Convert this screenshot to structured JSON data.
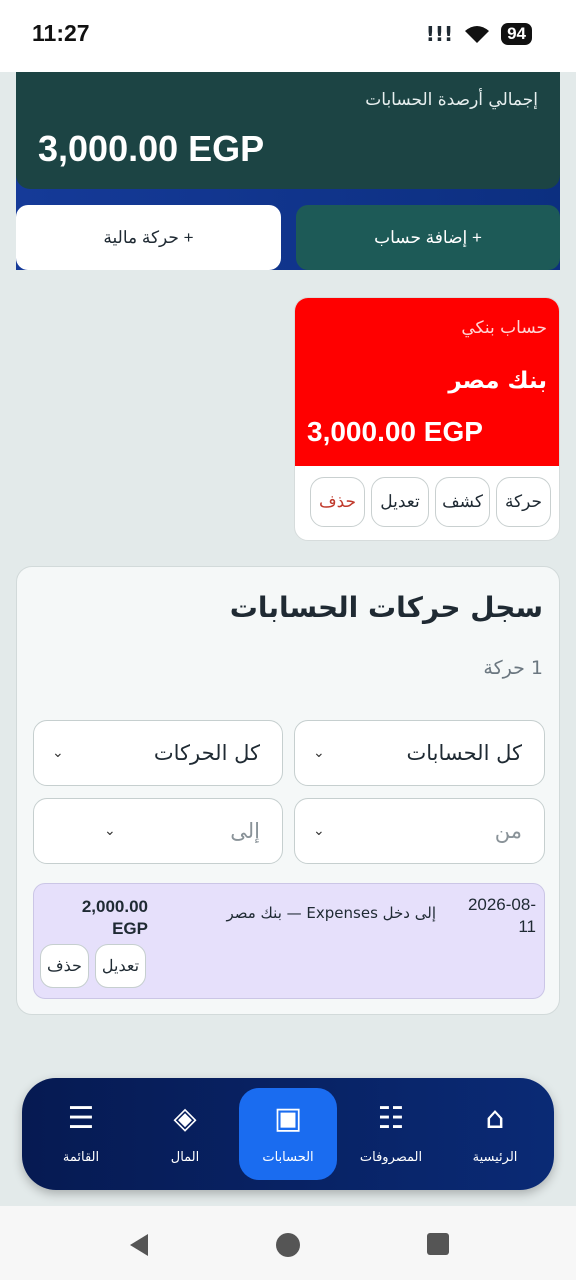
{
  "status_bar": {
    "time": "11:27",
    "battery": "94"
  },
  "summary": {
    "label": "إجمالي أرصدة الحسابات",
    "amount": "3,000.00 EGP"
  },
  "actions": {
    "add_transaction": "+ حركة مالية",
    "add_account": "+ إضافة حساب"
  },
  "account": {
    "type": "حساب بنكي",
    "name": "بنك مصر",
    "balance": "3,000.00 EGP",
    "color": "#ff0000",
    "buttons": [
      "حركة",
      "كشف",
      "تعديل",
      "حذف"
    ]
  },
  "log": {
    "title": "سجل حركات الحسابات",
    "count": "1 حركة",
    "filters": {
      "accounts": "كل الحسابات",
      "movements": "كل الحركات",
      "from": "من",
      "to": "إلى"
    },
    "transactions": [
      {
        "date": "2026-08-11",
        "description": "إلى دخل Expenses — بنك مصر",
        "amount": "2,000.00 EGP",
        "edit": "تعديل",
        "delete": "حذف"
      }
    ]
  },
  "nav": {
    "items": [
      {
        "label": "الرئيسية",
        "icon": "home-icon"
      },
      {
        "label": "المصروفات",
        "icon": "list-icon"
      },
      {
        "label": "الحسابات",
        "icon": "accounts-icon"
      },
      {
        "label": "المال",
        "icon": "diamond-icon"
      },
      {
        "label": "القائمة",
        "icon": "menu-icon"
      }
    ],
    "active": "الحسابات"
  }
}
